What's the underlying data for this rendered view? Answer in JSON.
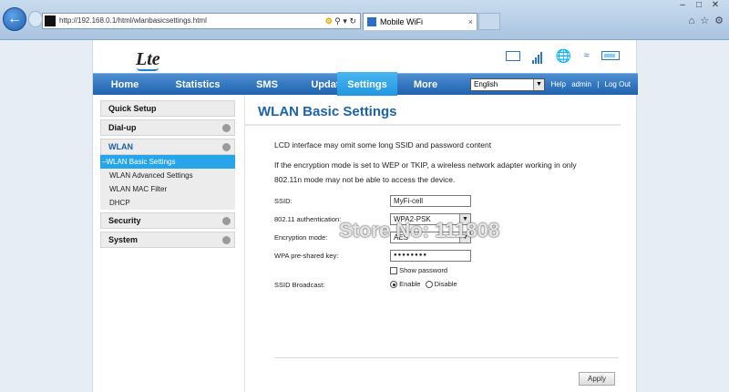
{
  "browser": {
    "url": "http://192.168.0.1/html/wlanbasicsettings.html",
    "tab_title": "Mobile WiFi",
    "tab_close": "×"
  },
  "header": {
    "logo": "Lte"
  },
  "nav": {
    "items": [
      "Home",
      "Statistics",
      "SMS",
      "Update",
      "Settings",
      "More"
    ],
    "active": "Settings",
    "language": "English",
    "links": [
      "Help",
      "admin",
      "Log Out"
    ]
  },
  "sidebar": {
    "items": [
      {
        "label": "Quick Setup"
      },
      {
        "label": "Dial-up"
      },
      {
        "label": "WLAN"
      },
      {
        "label": "Security"
      },
      {
        "label": "System"
      }
    ],
    "wlan_sub": [
      "WLAN Basic Settings",
      "WLAN Advanced Settings",
      "WLAN MAC Filter",
      "DHCP"
    ],
    "active_sub": "WLAN Basic Settings"
  },
  "main": {
    "title": "WLAN Basic Settings",
    "notice1": "LCD interface may omit some long SSID and password content",
    "notice2a": "If the encryption mode is set to WEP or TKIP, a wireless network adapter working in only",
    "notice2b": "802.11n mode may not be able to access the device.",
    "ssid_label": "SSID:",
    "ssid_value": "MyFi-cell",
    "auth_label": "802.11 authentication:",
    "auth_value": "WPA2-PSK",
    "enc_label": "Encryption mode:",
    "enc_value": "AES",
    "key_label": "WPA pre-shared key:",
    "key_value": "●●●●●●●●",
    "show_password": "Show password",
    "broadcast_label": "SSID Broadcast:",
    "enable": "Enable",
    "disable": "Disable",
    "apply": "Apply"
  },
  "watermark": "Store No: 111808"
}
